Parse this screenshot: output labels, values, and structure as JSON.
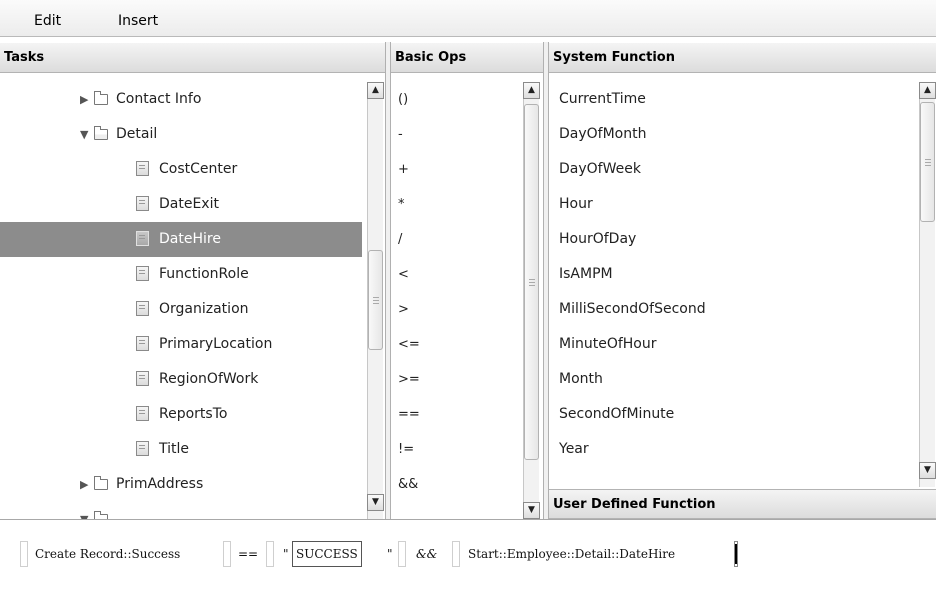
{
  "menu": {
    "edit": "Edit",
    "insert": "Insert"
  },
  "tasks": {
    "header": "Tasks",
    "items": [
      {
        "label": "Contact Info",
        "kind": "folder",
        "state": "collapsed"
      },
      {
        "label": "Detail",
        "kind": "folder",
        "state": "expanded"
      },
      {
        "label": "CostCenter",
        "kind": "file"
      },
      {
        "label": "DateExit",
        "kind": "file"
      },
      {
        "label": "DateHire",
        "kind": "file",
        "selected": true
      },
      {
        "label": "FunctionRole",
        "kind": "file"
      },
      {
        "label": "Organization",
        "kind": "file"
      },
      {
        "label": "PrimaryLocation",
        "kind": "file"
      },
      {
        "label": "RegionOfWork",
        "kind": "file"
      },
      {
        "label": "ReportsTo",
        "kind": "file"
      },
      {
        "label": "Title",
        "kind": "file"
      },
      {
        "label": "PrimAddress",
        "kind": "folder",
        "state": "collapsed"
      }
    ]
  },
  "basic_ops": {
    "header": "Basic Ops",
    "items": [
      "()",
      "-",
      "+",
      "*",
      "/",
      "<",
      ">",
      "<=",
      ">=",
      "==",
      "!=",
      "&&"
    ]
  },
  "system_function": {
    "header": "System Function",
    "items": [
      "CurrentTime",
      "DayOfMonth",
      "DayOfWeek",
      "Hour",
      "HourOfDay",
      "IsAMPM",
      "MilliSecondOfSecond",
      "MinuteOfHour",
      "Month",
      "SecondOfMinute",
      "Year"
    ]
  },
  "user_defined_function": {
    "header": "User Defined Function"
  },
  "expression": {
    "token1": "Create Record::Success",
    "token2": "==",
    "quote_open": "\"",
    "string_value": "SUCCESS",
    "quote_close": "\"",
    "token4": "&&",
    "token5": "Start::Employee::Detail::DateHire"
  },
  "icons": {
    "collapsed": "triangle-right-icon",
    "expanded": "triangle-down-icon",
    "folder": "folder-icon",
    "file": "file-icon"
  },
  "colors": {
    "selected_row": "#8c8c8c",
    "header_bg": "#dcdcdc"
  }
}
